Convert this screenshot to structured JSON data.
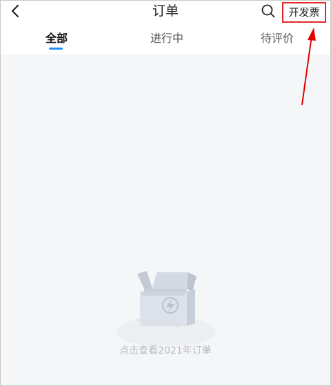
{
  "header": {
    "title": "订单",
    "invoice_label": "开发票"
  },
  "tabs": [
    {
      "label": "全部",
      "active": true
    },
    {
      "label": "进行中",
      "active": false
    },
    {
      "label": "待评价",
      "active": false
    }
  ],
  "empty_state": {
    "message": "点击查看2021年订单"
  },
  "colors": {
    "accent": "#1f8cff",
    "highlight_box": "#e0262b",
    "annotation_arrow": "#e00000"
  },
  "icons": [
    "back-icon",
    "search-icon",
    "empty-box-icon",
    "lightning-icon"
  ]
}
